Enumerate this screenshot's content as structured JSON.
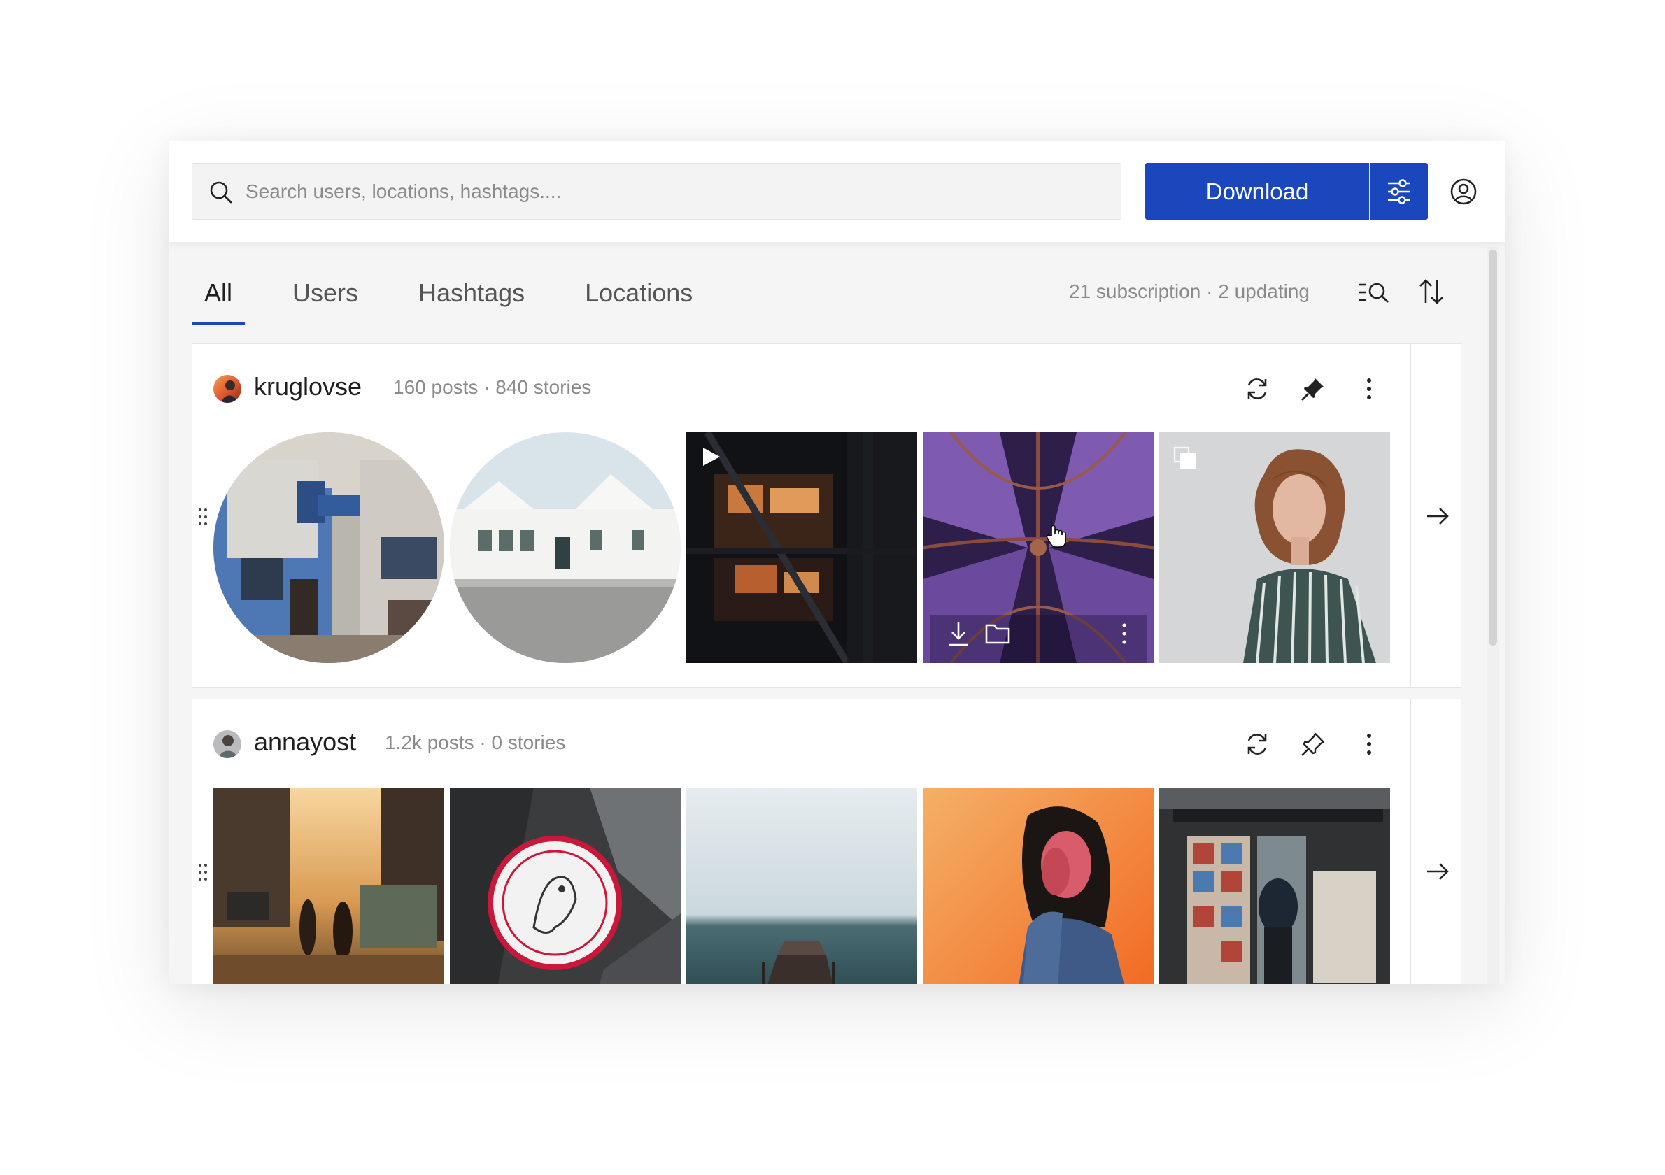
{
  "search": {
    "placeholder": "Search users, locations, hashtags...."
  },
  "toolbar": {
    "download_label": "Download"
  },
  "tabs": [
    {
      "label": "All",
      "active": true
    },
    {
      "label": "Users",
      "active": false
    },
    {
      "label": "Hashtags",
      "active": false
    },
    {
      "label": "Locations",
      "active": false
    }
  ],
  "status": {
    "text": "21 subscription · 2 updating"
  },
  "accent_color": "#1b47bd",
  "icons": {
    "search": "search-icon",
    "filter": "sliders-icon",
    "account": "user-circle-icon",
    "search_list": "list-search-icon",
    "sort": "sort-arrows-icon",
    "refresh": "refresh-icon",
    "pin": "pin-icon",
    "more": "more-vertical-icon",
    "drag": "drag-handle-icon",
    "next": "arrow-right-icon",
    "video": "play-icon",
    "carousel": "multiple-images-icon",
    "download": "download-icon",
    "folder": "folder-icon"
  },
  "subscriptions": [
    {
      "username": "kruglovse",
      "meta": "160 posts · 840 stories",
      "pinned": true,
      "media": [
        "story-blue-street",
        "story-white-houses",
        "video-building-night",
        "cathedral-ceiling",
        "carousel-portrait-woman"
      ]
    },
    {
      "username": "annayost",
      "meta": "1.2k posts · 0 stories",
      "pinned": false,
      "media": [
        "city-street-sunset",
        "ajax-logo-stadium",
        "foggy-sea-boat",
        "woman-orange-backdrop",
        "newsstand-kiosk"
      ]
    }
  ]
}
